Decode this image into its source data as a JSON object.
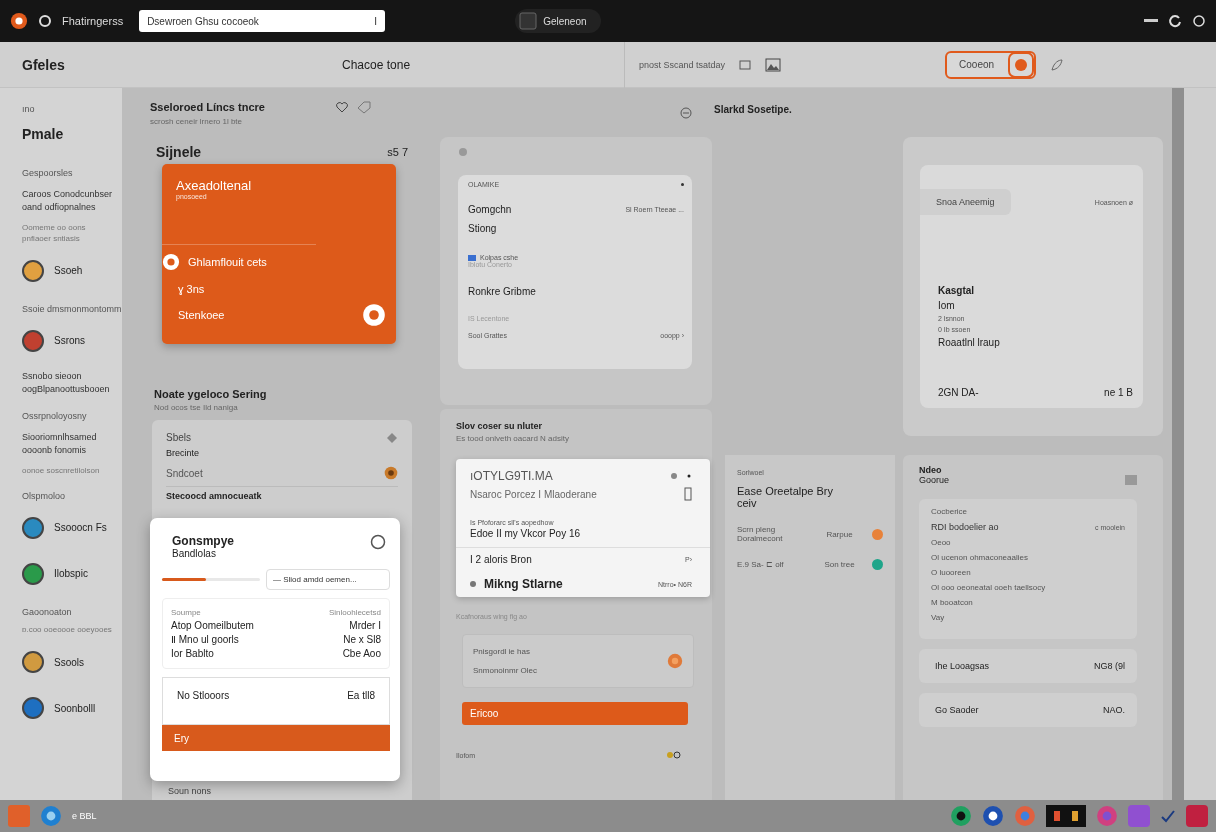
{
  "titlebar": {
    "app_name": "Fhatirngerss",
    "address": "Dsewroen Ghsu cocoeok",
    "address_end": "I",
    "tab": "Geleneon"
  },
  "header": {
    "title": "Gfeles",
    "center": "Chacoe tone",
    "hint": "pnost Sscand tsatday",
    "action": "Cooeon"
  },
  "sidebar": {
    "back": "ıno",
    "title": "Pmale",
    "items": [
      {
        "kind": "caption",
        "text": "Gespoorsles"
      },
      {
        "kind": "text",
        "text": "Caroos Conodcunbser oand odfiopnalnes"
      },
      {
        "kind": "note",
        "text": "Oomeme oo oons pnfiaoer sntiasis"
      },
      {
        "kind": "avatar",
        "text": "Ssoeh",
        "color": "#e0a040"
      },
      {
        "kind": "caption",
        "text": "Ssoie dmsmonmontomm"
      },
      {
        "kind": "avatar",
        "text": "Ssrons",
        "color": "#c04030"
      },
      {
        "kind": "text",
        "text": "Ssnobo sieoon oogBlpanoottusbooen"
      },
      {
        "kind": "caption",
        "text": "Ossrpnoloyosny"
      },
      {
        "kind": "text",
        "text": "Siooriomnlhsamed oooonb fonomis"
      },
      {
        "kind": "note",
        "text": "oonoe soscnretilolson"
      },
      {
        "kind": "caption",
        "text": "Olspmoloo"
      },
      {
        "kind": "avatar",
        "text": "Ssooocn Fs",
        "color": "#2a8abf"
      },
      {
        "kind": "avatar",
        "text": "Ilobspic",
        "color": "#2a9a4a"
      },
      {
        "kind": "caption",
        "text": "Gaoonoaton"
      },
      {
        "kind": "note",
        "text": "ɒ.coo ooeoooe ooeyooes"
      },
      {
        "kind": "avatar",
        "text": "Ssools",
        "color": "#d09a40"
      },
      {
        "kind": "avatar",
        "text": "Soonbolll",
        "color": "#1e6fc0"
      }
    ]
  },
  "feature": {
    "title": "Sseloroed Líncs tncre",
    "subtitle": "scrosh ceneir lrnero 1l bte",
    "label": "Sijnele",
    "count": "s5 7",
    "card": {
      "title": "Axeadoltenal",
      "subtitle": "pnosoeed",
      "row": "Ghlamflouit cets",
      "meta": "ɣ 3ns",
      "footer": "Stenkoee"
    }
  },
  "section": {
    "title": "Noate ygeloco Sering",
    "subtitle": "Nod ocos tse Ild naniga",
    "card": {
      "title": "Sbels",
      "subtitle": "Brecinte",
      "row": "Sndcoet",
      "footer_top": "Stecoocd amnocueatk",
      "footer": "Soun nons"
    }
  },
  "dialog": {
    "title": "Gonsmpye",
    "subtitle": "Bandlolas",
    "field": "— Sliod amdd oemen...",
    "level": 0.45,
    "columns": [
      "Soumpe",
      "Sinloohlecetsd"
    ],
    "rows": [
      [
        "Atop Oomeilbutem",
        "Mrder I"
      ],
      [
        "Ⅱ Mno  ul goorls",
        "Ne x Sl8"
      ],
      [
        "Ior Bablto",
        "Cbe Aoo"
      ]
    ],
    "box": [
      "No Stlooors",
      "Ea tll8"
    ],
    "button": "Ery"
  },
  "preview": {
    "overline": "OLAMIKE",
    "title": "Gomgchn",
    "tag": "Sl Roern Tteeae ...",
    "subtitle": "Stiong",
    "chip": "Kolpas cshe",
    "note": "Iblotu Conerto",
    "heading": "Ronkre Gribme",
    "caption": "IS Lecentone",
    "footer": "Sool Grattes",
    "footer_end": "ooopp ›"
  },
  "list_panel": {
    "title": "Slov coser su nluter",
    "subtitle": "Es tood onlveth oacard N adsity",
    "card": {
      "code": "ıOTYLG9TI.MA",
      "line": "Nsaroc Porcez I Mlaoderane",
      "small": "Is Pfoforarc sll's aopedhow",
      "detail": "Edoe II my Vkcor Poy 16",
      "items": [
        {
          "text": "I 2 aloris Bron",
          "end": "P›",
          "bullet": false
        },
        {
          "text": "Mikng Stlarne",
          "end": "Ntrro• N6R",
          "bullet": true
        }
      ]
    },
    "note": "Kcafnoraus wing fig ao",
    "field": {
      "label": "Pnisgordl ie has",
      "value": "Snmonoinmr Olec"
    },
    "button": "Ericoo",
    "footer": "Ilofom"
  },
  "side_heading": "Slarkd Sosetipe.",
  "summary": {
    "chip": "Snoa Aneemig",
    "tag": "Hoasnoen ø",
    "title": "Kasgtal",
    "subtitle": "Iom",
    "lines": [
      "2 lsnnon",
      "0 Ib ssoen"
    ],
    "label": "Roaatlnl lraup",
    "date": "2GN DA-",
    "end": "ne 1 B"
  },
  "status_list": {
    "title_small": "Sorlwoel",
    "title": "Ease Oreetalpe Bry ceiv",
    "items": [
      {
        "name": "Scrn pleng Doralmecont",
        "value": "Rarpue",
        "color": "#e8823a"
      },
      {
        "name": "E.9 Sa-  ⊏ olf",
        "value": "Son tree",
        "color": "#1fa58a"
      }
    ]
  },
  "detail_panel": {
    "title": "Ndeo",
    "subtitle": "Goorue",
    "card_title": "Cocberice",
    "head": "RDI bodoelier ao",
    "head_end": "c moolein",
    "lines": [
      "Oeoo",
      "Ol ucenon ohmaconeaalies",
      "O luooreen",
      "Ol ooo oeoneatal ooeh taellsocy",
      "M booatcon",
      "Vay"
    ],
    "rows": [
      {
        "label": "Ihe Looagsas",
        "value": "NG8 (9l"
      },
      {
        "label": "Go Saoder",
        "value": "NAO."
      }
    ]
  },
  "taskbar": {
    "label": "e BBL"
  }
}
